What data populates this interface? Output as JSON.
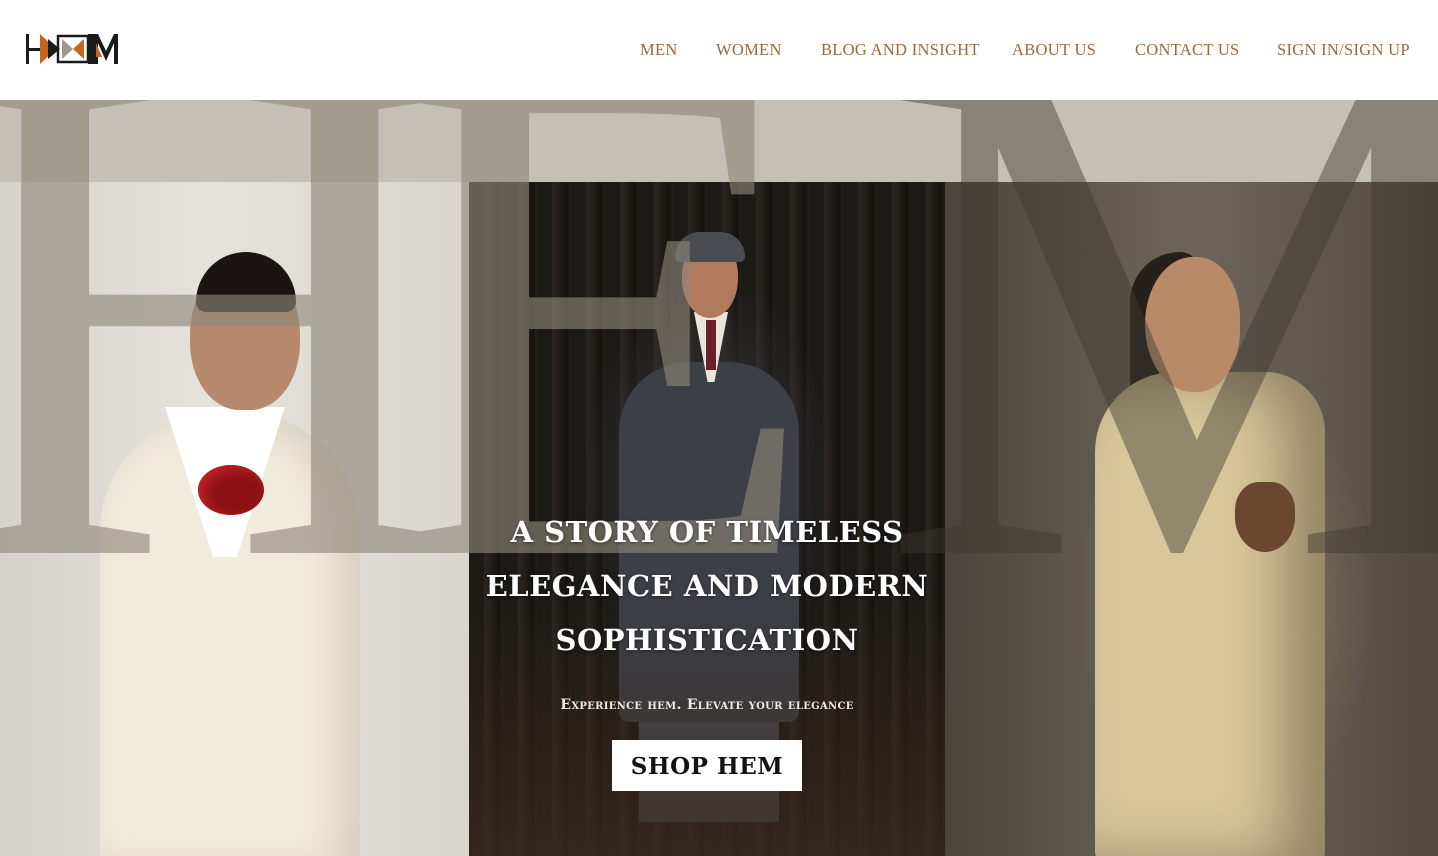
{
  "brand": {
    "logo_text": "HEM",
    "colors": {
      "accent": "#9a6a3a",
      "logo_dark": "#1a1a1a",
      "logo_orange": "#c8641e"
    }
  },
  "nav": {
    "items": [
      {
        "label": "MEN"
      },
      {
        "label": "WOMEN"
      },
      {
        "label": "BLOG AND INSIGHT"
      },
      {
        "label": "ABOUT US"
      },
      {
        "label": "CONTACT US"
      },
      {
        "label": "SIGN IN/SIGN UP"
      }
    ]
  },
  "hero": {
    "background_letters": [
      "H",
      "E",
      "M"
    ],
    "title_lines": [
      "A STORY OF TIMELESS",
      "ELEGANCE AND MODERN",
      "SOPHISTICATION"
    ],
    "subtitle": "Experience hem. Elevate your elegance",
    "cta_label": "SHOP HEM",
    "images": [
      "woman-cream-suit-red-rose",
      "man-tweed-suit-forest",
      "woman-cream-suit-dried-flower"
    ]
  }
}
